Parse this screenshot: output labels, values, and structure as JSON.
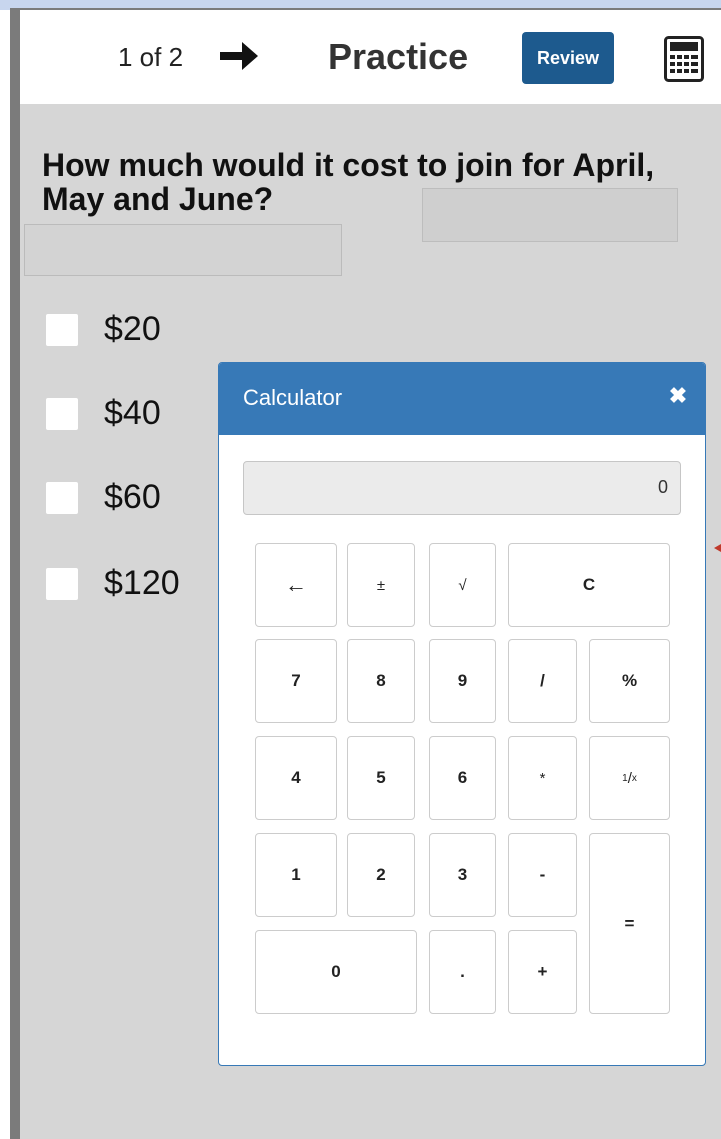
{
  "header": {
    "counter": "1 of 2",
    "title": "Practice",
    "review_label": "Review",
    "next_icon": "arrow-right-icon",
    "calculator_icon": "calculator-icon"
  },
  "question": {
    "text": "How much would it cost to join for April, May and June?"
  },
  "options": [
    {
      "label": "$20",
      "checked": false
    },
    {
      "label": "$40",
      "checked": false
    },
    {
      "label": "$60",
      "checked": false
    },
    {
      "label": "$120",
      "checked": false
    }
  ],
  "calculator": {
    "title": "Calculator",
    "close_icon": "close-icon",
    "display": "0",
    "keys": {
      "backspace": "←",
      "plus_minus": "±",
      "sqrt": "√",
      "clear": "C",
      "k7": "7",
      "k8": "8",
      "k9": "9",
      "divide": "/",
      "percent": "%",
      "k4": "4",
      "k5": "5",
      "k6": "6",
      "multiply": "*",
      "reciprocal_num": "1",
      "reciprocal_den": "x",
      "k1": "1",
      "k2": "2",
      "k3": "3",
      "minus": "-",
      "equals": "=",
      "k0": "0",
      "decimal": ".",
      "plus": "+"
    }
  },
  "colors": {
    "header_bg": "#ffffff",
    "panel_bg": "#d6d6d6",
    "review_bg": "#1d5a8e",
    "calc_header_bg": "#3779b7"
  }
}
